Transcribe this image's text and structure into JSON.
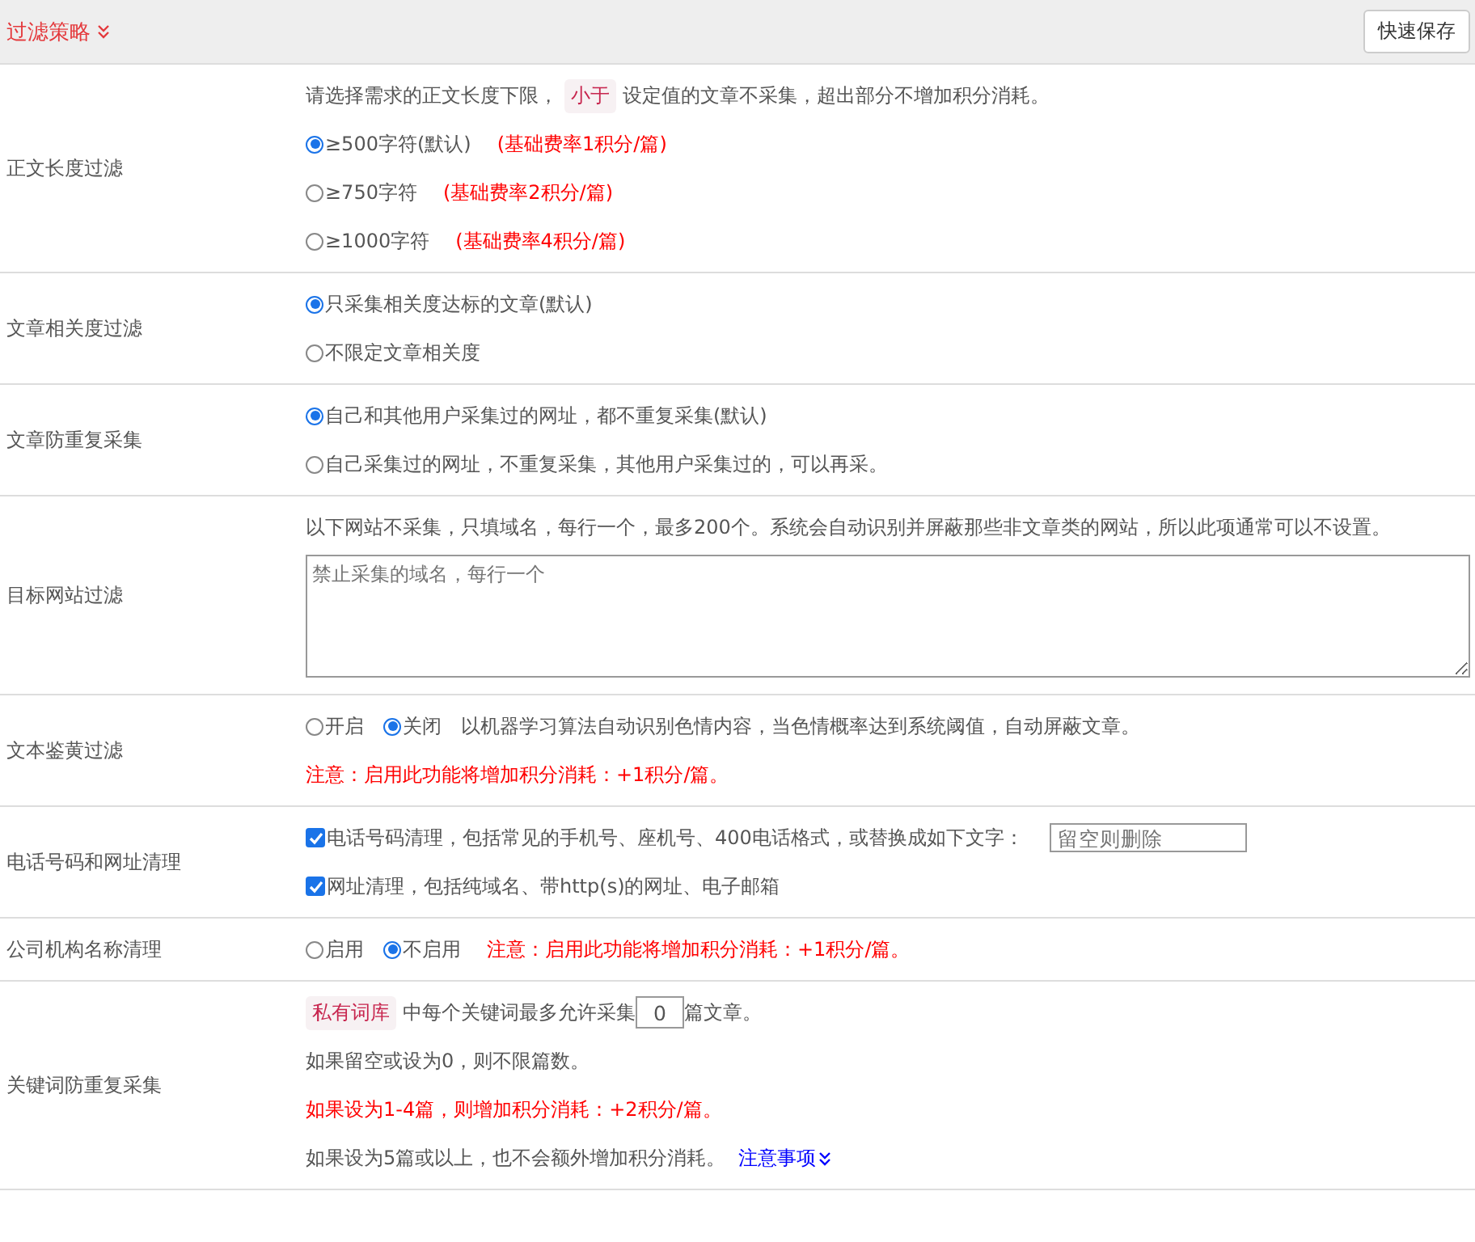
{
  "header": {
    "title": "过滤策略",
    "button": "快速保存"
  },
  "rows": [
    {
      "label": "正文长度过滤",
      "lines": [
        [
          {
            "kind": "text",
            "text": "请选择需求的正文长度下限，"
          },
          {
            "kind": "tag",
            "text": "小于"
          },
          {
            "kind": "text",
            "text": "设定值的文章不采集，超出部分不增加积分消耗。"
          }
        ],
        [
          {
            "kind": "radio",
            "label": "≥500字符(默认)",
            "selected": true
          },
          {
            "kind": "note",
            "text": "(基础费率1积分/篇)"
          }
        ],
        [
          {
            "kind": "radio",
            "label": "≥750字符",
            "selected": false
          },
          {
            "kind": "note",
            "text": "(基础费率2积分/篇)"
          }
        ],
        [
          {
            "kind": "radio",
            "label": "≥1000字符",
            "selected": false
          },
          {
            "kind": "note",
            "text": "(基础费率4积分/篇)"
          }
        ]
      ]
    },
    {
      "label": "文章相关度过滤",
      "lines": [
        [
          {
            "kind": "radio",
            "label": "只采集相关度达标的文章(默认)",
            "selected": true
          }
        ],
        [
          {
            "kind": "radio",
            "label": "不限定文章相关度",
            "selected": false
          }
        ]
      ]
    },
    {
      "label": "文章防重复采集",
      "lines": [
        [
          {
            "kind": "radio",
            "label": "自己和其他用户采集过的网址，都不重复采集(默认)",
            "selected": true
          }
        ],
        [
          {
            "kind": "radio",
            "label": "自己采集过的网址，不重复采集，其他用户采集过的，可以再采。",
            "selected": false
          }
        ]
      ]
    },
    {
      "label": "目标网站过滤",
      "lines": [
        [
          {
            "kind": "text",
            "text": "以下网站不采集，只填域名，每行一个，最多200个。系统会自动识别并屏蔽那些非文章类的网站，所以此项通常可以不设置。"
          }
        ],
        [
          {
            "kind": "textarea",
            "placeholder": "禁止采集的域名，每行一个"
          }
        ]
      ]
    },
    {
      "label": "文本鉴黄过滤",
      "lines": [
        [
          {
            "kind": "radio",
            "label": "开启",
            "selected": false
          },
          {
            "kind": "radio",
            "label": "关闭",
            "selected": true
          },
          {
            "kind": "text",
            "text": "以机器学习算法自动识别色情内容，当色情概率达到系统阈值，自动屏蔽文章。"
          }
        ],
        [
          {
            "kind": "note",
            "text": "注意：启用此功能将增加积分消耗：+1积分/篇。"
          }
        ]
      ]
    },
    {
      "label": "电话号码和网址清理",
      "lines": [
        [
          {
            "kind": "checkbox",
            "label": "电话号码清理，包括常见的手机号、座机号、400电话格式，或替换成如下文字：",
            "checked": true
          },
          {
            "kind": "input",
            "placeholder": "留空则删除"
          }
        ],
        [
          {
            "kind": "checkbox",
            "label": "网址清理，包括纯域名、带http(s)的网址、电子邮箱",
            "checked": true
          }
        ]
      ]
    },
    {
      "label": "公司机构名称清理",
      "lines": [
        [
          {
            "kind": "radio",
            "label": "启用",
            "selected": false
          },
          {
            "kind": "radio",
            "label": "不启用",
            "selected": true
          },
          {
            "kind": "note",
            "text": "注意：启用此功能将增加积分消耗：+1积分/篇。"
          }
        ]
      ]
    },
    {
      "label": "关键词防重复采集",
      "lines": [
        [
          {
            "kind": "tag",
            "text": "私有词库"
          },
          {
            "kind": "text",
            "text": "中每个关键词最多允许采集"
          },
          {
            "kind": "input",
            "value": "0"
          },
          {
            "kind": "text",
            "text": "篇文章。"
          }
        ],
        [
          {
            "kind": "text",
            "text": "如果留空或设为0，则不限篇数。"
          }
        ],
        [
          {
            "kind": "note",
            "text": "如果设为1-4篇，则增加积分消耗：+2积分/篇。"
          }
        ],
        [
          {
            "kind": "text",
            "text": "如果设为5篇或以上，也不会额外增加积分消耗。"
          },
          {
            "kind": "link",
            "text": "注意事项"
          }
        ]
      ]
    }
  ]
}
